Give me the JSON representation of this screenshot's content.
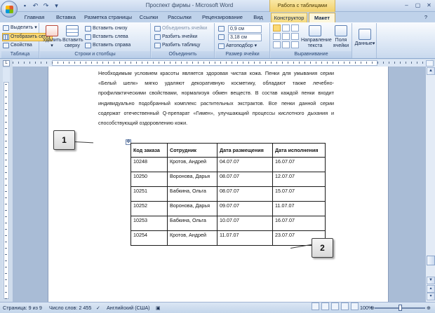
{
  "window": {
    "title": "Проспект фирмы - Microsoft Word",
    "context_title": "Работа с таблицами"
  },
  "tabs": [
    "Главная",
    "Вставка",
    "Разметка страницы",
    "Ссылки",
    "Рассылки",
    "Рецензирование",
    "Вид",
    "Конструктор",
    "Макет"
  ],
  "active_tab": "Макет",
  "ribbon": {
    "table_group": {
      "label": "Таблица",
      "select": "Выделить",
      "show_grid": "Отобразить сетку",
      "properties": "Свойства"
    },
    "rows_cols_group": {
      "label": "Строки и столбцы",
      "delete": "Удалить",
      "insert_above": "Вставить сверху",
      "insert_below": "Вставить снизу",
      "insert_left": "Вставить слева",
      "insert_right": "Вставить справа"
    },
    "merge_group": {
      "label": "Объединить",
      "merge_cells": "Объединить ячейки",
      "split_cells": "Разбить ячейки",
      "split_table": "Разбить таблицу"
    },
    "cell_size_group": {
      "label": "Размер ячейки",
      "height": "0,9 см",
      "width": "3,18 см",
      "autofit": "Автоподбор"
    },
    "alignment_group": {
      "label": "Выравнивание",
      "text_direction": "Направление текста",
      "cell_margins": "Поля ячейки"
    },
    "data_group": {
      "label": "Данные"
    }
  },
  "document": {
    "paragraph": "Необходимым условием красоты является здоровая чистая кожа. Пенки для умывания серии «Белый шелк» мягко удаляют декоративную косметику, обладают также лечебно-профилактическими свойствами, нормализуя обмен веществ. В состав каждой пенки входит индивидуально подобранный комплекс растительных экстрактов. Все пенки данной серии содержат отечественный Q-препарат «Гимен», улучшающий процессы кислотного дыхания и способствующий оздоровлению кожи.",
    "table": {
      "headers": [
        "Код заказа",
        "Сотрудник",
        "Дата размещения",
        "Дата исполнения"
      ],
      "rows": [
        [
          "10248",
          "Кротов, Андрей",
          "04.07.07",
          "16.07.07"
        ],
        [
          "10250",
          "Воронова, Дарья",
          "08.07.07",
          "12.07.07"
        ],
        [
          "10251",
          "Бабкина, Ольга",
          "08.07.07",
          "15.07.07"
        ],
        [
          "10252",
          "Воронова, Дарья",
          "09.07.07",
          "11.07.07"
        ],
        [
          "10253",
          "Бабкина, Ольга",
          "10.07.07",
          "16.07.07"
        ],
        [
          "10254",
          "Кротов, Андрей",
          "11.07.07",
          "23.07.07"
        ]
      ]
    },
    "table_handle_glyph": "✥"
  },
  "callouts": [
    "1",
    "2"
  ],
  "statusbar": {
    "page": "Страница: 9 из 9",
    "words": "Число слов: 2 455",
    "language": "Английский (США)",
    "zoom": "100%"
  },
  "icons": {
    "save": "save-icon",
    "undo": "undo-icon",
    "redo": "redo-icon"
  }
}
